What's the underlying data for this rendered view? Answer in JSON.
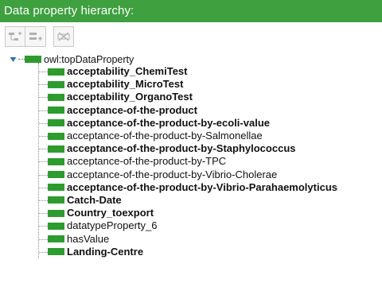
{
  "panel": {
    "title": "Data property hierarchy:"
  },
  "toolbar": {
    "buttons": [
      {
        "name": "add-subproperty-button",
        "icon": "add-sub-property-icon"
      },
      {
        "name": "add-sibling-property-button",
        "icon": "add-sibling-property-icon"
      },
      {
        "name": "delete-property-button",
        "icon": "delete-property-icon"
      }
    ]
  },
  "tree": {
    "root": {
      "label": "owl:topDataProperty",
      "expanded": true
    },
    "items": [
      {
        "label": "acceptability_ChemiTest",
        "bold": true
      },
      {
        "label": "acceptability_MicroTest",
        "bold": true
      },
      {
        "label": "acceptability_OrganoTest",
        "bold": true
      },
      {
        "label": "acceptance-of-the-product",
        "bold": true
      },
      {
        "label": "acceptance-of-the-product-by-ecoli-value",
        "bold": true
      },
      {
        "label": "acceptance-of-the-product-by-Salmonellae",
        "bold": false
      },
      {
        "label": "acceptance-of-the-product-by-Staphylococcus",
        "bold": true
      },
      {
        "label": "acceptance-of-the-product-by-TPC",
        "bold": false
      },
      {
        "label": "acceptance-of-the-product-by-Vibrio-Cholerae",
        "bold": false
      },
      {
        "label": "acceptance-of-the-product-by-Vibrio-Parahaemolyticus",
        "bold": true
      },
      {
        "label": "Catch-Date",
        "bold": true
      },
      {
        "label": "Country_toexport",
        "bold": true
      },
      {
        "label": "datatypeProperty_6",
        "bold": false
      },
      {
        "label": "hasValue",
        "bold": false
      },
      {
        "label": "Landing-Centre",
        "bold": true
      }
    ]
  },
  "colors": {
    "header_bg": "#3fa03f",
    "swatch": "#2e9b2e"
  }
}
